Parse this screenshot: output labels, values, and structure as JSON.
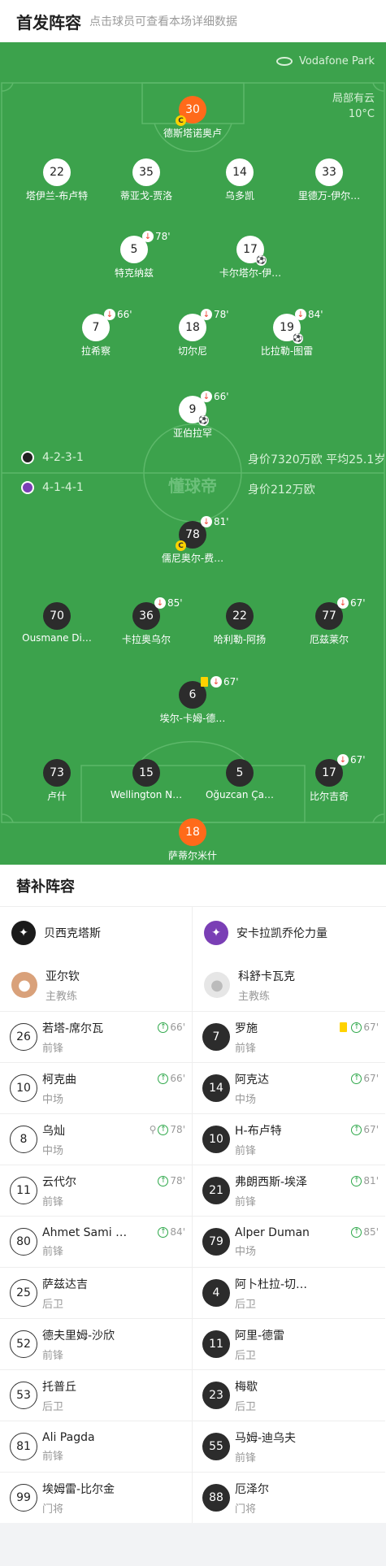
{
  "header": {
    "title": "首发阵容",
    "subtitle": "点击球员可查看本场详细数据"
  },
  "pitch": {
    "venue": "Vodafone Park",
    "weather": "局部有云",
    "temperature": "10°C",
    "watermark": "懂球帝",
    "home": {
      "formation": "4-2-3-1",
      "value": "身价7320万欧 平均25.1岁"
    },
    "away": {
      "formation": "4-1-4-1",
      "value": "身价212万欧"
    }
  },
  "home_players": [
    {
      "num": "30",
      "name": "德斯塔诺奥卢",
      "captain": true
    },
    {
      "num": "22",
      "name": "塔伊兰-布卢特"
    },
    {
      "num": "35",
      "name": "蒂亚戈-贾洛"
    },
    {
      "num": "14",
      "name": "乌多凯"
    },
    {
      "num": "33",
      "name": "里德万-伊尔…"
    },
    {
      "num": "5",
      "name": "特克纳兹",
      "sub": "78'"
    },
    {
      "num": "17",
      "name": "卡尔塔尔-伊…",
      "goal": true
    },
    {
      "num": "7",
      "name": "拉希察",
      "sub": "66'"
    },
    {
      "num": "18",
      "name": "切尔尼",
      "sub": "78'"
    },
    {
      "num": "19",
      "name": "比拉勒-图雷",
      "sub": "84'",
      "goal": true
    },
    {
      "num": "9",
      "name": "亚伯拉罕",
      "sub": "66'",
      "goal": true
    }
  ],
  "away_players": [
    {
      "num": "78",
      "name": "儒尼奥尔-费…",
      "sub": "81'",
      "captain": true
    },
    {
      "num": "70",
      "name": "Ousmane Di…"
    },
    {
      "num": "36",
      "name": "卡拉奥乌尔",
      "sub": "85'"
    },
    {
      "num": "22",
      "name": "哈利勒-阿扬"
    },
    {
      "num": "77",
      "name": "厄兹莱尔",
      "sub": "67'"
    },
    {
      "num": "6",
      "name": "埃尔-卡姆-德…",
      "sub": "67'",
      "yellow": true
    },
    {
      "num": "73",
      "name": "卢什"
    },
    {
      "num": "15",
      "name": "Wellington N…"
    },
    {
      "num": "5",
      "name": "Oğuzcan Ça…"
    },
    {
      "num": "17",
      "name": "比尔吉奇",
      "sub": "67'"
    },
    {
      "num": "18",
      "name": "萨蒂尔米什"
    }
  ],
  "subs": {
    "title": "替补阵容",
    "home": {
      "team": "贝西克塔斯",
      "coach": "亚尔钦",
      "coach_role": "主教练",
      "players": [
        {
          "num": "26",
          "name": "若塔-席尔瓦",
          "pos": "前锋",
          "min": "66'"
        },
        {
          "num": "10",
          "name": "柯克曲",
          "pos": "中场",
          "min": "66'"
        },
        {
          "num": "8",
          "name": "乌灿",
          "pos": "中场",
          "min": "78'",
          "assist": true
        },
        {
          "num": "11",
          "name": "云代尔",
          "pos": "前锋",
          "min": "78'"
        },
        {
          "num": "80",
          "name": "Ahmet Sami …",
          "pos": "前锋",
          "min": "84'"
        },
        {
          "num": "25",
          "name": "萨兹达吉",
          "pos": "后卫"
        },
        {
          "num": "52",
          "name": "德夫里姆-沙欣",
          "pos": "前锋"
        },
        {
          "num": "53",
          "name": "托普丘",
          "pos": "后卫"
        },
        {
          "num": "81",
          "name": "Ali Pagda",
          "pos": "前锋"
        },
        {
          "num": "99",
          "name": "埃姆雷-比尔金",
          "pos": "门将"
        }
      ]
    },
    "away": {
      "team": "安卡拉凯乔伦力量",
      "coach": "科舒卡瓦克",
      "coach_role": "主教练",
      "players": [
        {
          "num": "7",
          "name": "罗施",
          "pos": "前锋",
          "min": "67'",
          "yellow": true
        },
        {
          "num": "14",
          "name": "阿克达",
          "pos": "中场",
          "min": "67'"
        },
        {
          "num": "10",
          "name": "H-布卢特",
          "pos": "前锋",
          "min": "67'"
        },
        {
          "num": "21",
          "name": "弗朗西斯-埃泽",
          "pos": "前锋",
          "min": "81'"
        },
        {
          "num": "79",
          "name": "Alper Duman",
          "pos": "中场",
          "min": "85'"
        },
        {
          "num": "4",
          "name": "阿卜杜拉-切…",
          "pos": "后卫"
        },
        {
          "num": "11",
          "name": "阿里-德雷",
          "pos": "后卫"
        },
        {
          "num": "23",
          "name": "梅歇",
          "pos": "后卫"
        },
        {
          "num": "55",
          "name": "马姆-迪乌夫",
          "pos": "前锋"
        },
        {
          "num": "88",
          "name": "厄泽尔",
          "pos": "门将"
        }
      ]
    }
  },
  "colors": {
    "pitch": "#3ca24c",
    "goalkeeper": "#ff6a1a",
    "away_kit": "#2c2c2c",
    "home_kit": "#ffffff"
  }
}
